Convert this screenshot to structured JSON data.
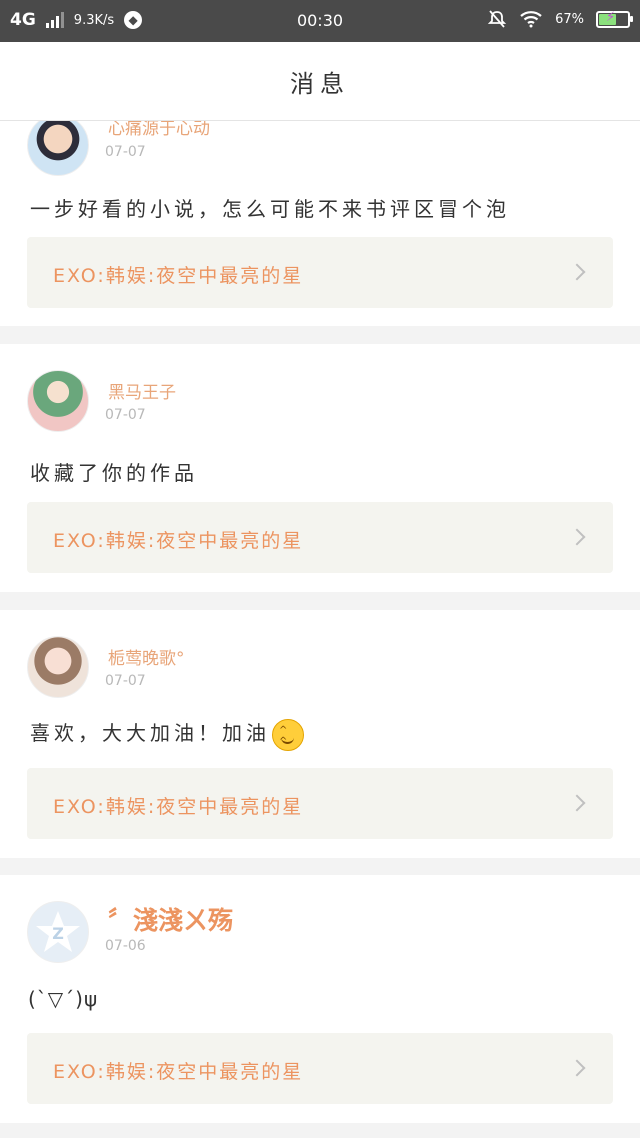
{
  "status_bar": {
    "network": "4G",
    "speed": "9.3K/s",
    "time": "00:30",
    "battery": "67%",
    "battery_level": 0.67
  },
  "header": {
    "title": "消息"
  },
  "messages": [
    {
      "username": "心痛源于心动",
      "date": "07-07",
      "content": "一步好看的小说，怎么可能不来书评区冒个泡",
      "link_title": "EXO:韩娱:夜空中最亮的星"
    },
    {
      "username": "黑马王子",
      "date": "07-07",
      "content": "收藏了你的作品",
      "link_title": "EXO:韩娱:夜空中最亮的星"
    },
    {
      "username": "栀莺晚歌°",
      "date": "07-07",
      "content": "喜欢，大大加油！加油",
      "link_title": "EXO:韩娱:夜空中最亮的星"
    },
    {
      "username": "〞淺淺ㄨ殇",
      "date": "07-06",
      "content": "(ˋ▽ˊ)ψ",
      "link_title": "EXO:韩娱:夜空中最亮的星"
    }
  ],
  "icons": {
    "silent": "bell-off-icon",
    "wifi": "wifi-icon",
    "chevron": "chevron-right-icon",
    "emoji": "smile-emoji-icon"
  },
  "colors": {
    "accent_orange": "#ec9460",
    "username": "#e8a579",
    "link_bg": "#f4f4ef",
    "status_bg": "#4a4a4a"
  }
}
